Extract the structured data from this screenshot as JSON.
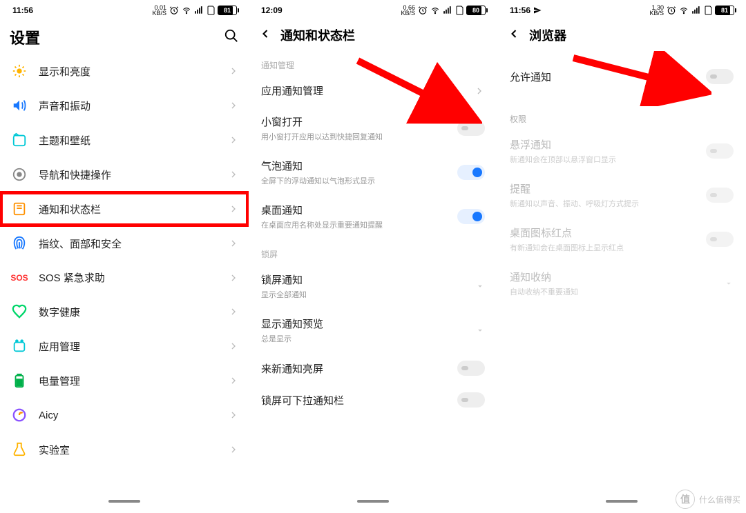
{
  "screens": {
    "settings": {
      "time": "11:56",
      "speed_top": "0.01",
      "speed_bot": "KB/S",
      "battery": "81",
      "batteryPct": 81,
      "title": "设置",
      "items": [
        {
          "icon": "brightness",
          "label": "显示和亮度",
          "color": "#ffb300"
        },
        {
          "icon": "sound",
          "label": "声音和振动",
          "color": "#1878ff"
        },
        {
          "icon": "theme",
          "label": "主题和壁纸",
          "color": "#00c8d6"
        },
        {
          "icon": "nav",
          "label": "导航和快捷操作",
          "color": "#888"
        },
        {
          "icon": "notif",
          "label": "通知和状态栏",
          "color": "#ff9100",
          "highlight": true
        },
        {
          "icon": "finger",
          "label": "指纹、面部和安全",
          "color": "#1878ff"
        },
        {
          "icon": "sos",
          "label": "SOS 紧急求助",
          "color": "#ff3030",
          "textIcon": "SOS"
        },
        {
          "icon": "health",
          "label": "数字健康",
          "color": "#00d66a"
        },
        {
          "icon": "apps",
          "label": "应用管理",
          "color": "#00c8d6"
        },
        {
          "icon": "battery",
          "label": "电量管理",
          "color": "#00b04a"
        },
        {
          "icon": "aicy",
          "label": "Aicy",
          "color": "#8a52ff"
        },
        {
          "icon": "lab",
          "label": "实验室",
          "color": "#ffb300"
        }
      ]
    },
    "notif": {
      "time": "12:09",
      "speed_top": "0.66",
      "speed_bot": "KB/S",
      "battery": "80",
      "batteryPct": 80,
      "title": "通知和状态栏",
      "sections": {
        "mgmt": "通知管理",
        "lock": "锁屏"
      },
      "rows": {
        "appMgmt": {
          "title": "应用通知管理"
        },
        "popup": {
          "title": "小窗打开",
          "sub": "用小窗打开应用以达到快捷回复通知",
          "on": false
        },
        "bubble": {
          "title": "气泡通知",
          "sub": "全屏下的浮动通知以气泡形式显示",
          "on": true
        },
        "desktop": {
          "title": "桌面通知",
          "sub": "在桌面应用名称处显示重要通知提醒",
          "on": true
        },
        "lockNotif": {
          "title": "锁屏通知",
          "sub": "显示全部通知"
        },
        "preview": {
          "title": "显示通知预览",
          "sub": "总是显示"
        },
        "wake": {
          "title": "来新通知亮屏",
          "on": false
        },
        "pull": {
          "title": "锁屏可下拉通知栏",
          "on": false
        }
      }
    },
    "browser": {
      "time": "11:56",
      "speed_top": "1.30",
      "speed_bot": "KB/S",
      "battery": "81",
      "batteryPct": 81,
      "title": "浏览器",
      "allow": "允许通知",
      "sections": {
        "perm": "权限"
      },
      "rows": {
        "float": {
          "title": "悬浮通知",
          "sub": "新通知会在顶部以悬浮窗口显示"
        },
        "alert": {
          "title": "提醒",
          "sub": "新通知以声音、振动、呼吸灯方式提示"
        },
        "dot": {
          "title": "桌面图标红点",
          "sub": "有新通知会在桌面图标上显示红点"
        },
        "store": {
          "title": "通知收纳",
          "sub": "自动收纳不重要通知"
        }
      }
    }
  },
  "watermark": {
    "char": "值",
    "text": "什么值得买"
  },
  "sendIconViewbox": "0 0 24 24"
}
